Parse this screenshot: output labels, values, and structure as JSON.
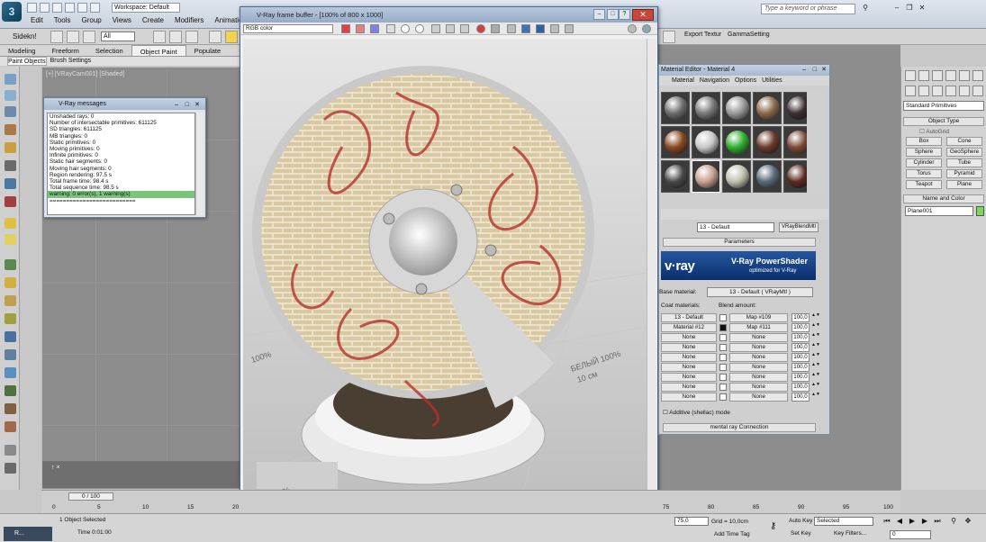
{
  "max": {
    "workspace": "Workspace: Default",
    "menu": [
      "Edit",
      "Tools",
      "Group",
      "Views",
      "Create",
      "Modifiers",
      "Animation"
    ],
    "help_search_placeholder": "Type a keyword or phrase",
    "selection_filter": "All",
    "select_mode": "Sidekn!",
    "toolbar_right": {
      "export": "Export Textur",
      "gamma": "GammaSetting"
    },
    "ribbon_tabs": [
      "Modeling",
      "Freeform",
      "Selection",
      "Object Paint",
      "Populate"
    ],
    "subribbon": [
      "Paint Objects",
      "Brush Settings"
    ]
  },
  "viewport": {
    "label": "[+] [VRayCam001] [Shaded]"
  },
  "vray_messages": {
    "title": "V-Ray messages",
    "lines": [
      "Unshaded rays: 0",
      "Number of intersectable primitives: 611125",
      "  SD triangles: 611125",
      "  MB triangles: 0",
      "  Static primitives: 0",
      "  Moving primitives: 0",
      "  Infinite primitives: 0",
      "  Static hair segments: 0",
      "  Moving hair segments: 0",
      "Region rendering: 97.5 s",
      "Total frame time: 98.4 s",
      "Total sequence time: 98.5 s",
      "warning: 0 error(s), 1 warning(s)",
      "=========================="
    ]
  },
  "vfb": {
    "title": "V-Ray frame buffer - [100% of 800 x 1000]",
    "channel": "RGB color",
    "scene_text": [
      "БЕЛЫЙ 100%",
      "10 см",
      "100%",
      "ЛЫЙ 100%",
      "см"
    ]
  },
  "material_editor": {
    "title": "Material Editor - Material 4",
    "menu": [
      "Material",
      "Navigation",
      "Options",
      "Utilities"
    ],
    "name_field": "13 - Default",
    "type_button": "VRayBlendMtl",
    "params_rollout": "Parameters",
    "banner": {
      "logo": "v·ray",
      "product": "V-Ray PowerShader",
      "subtitle": "optimized for V-Ray"
    },
    "base_label": "Base material:",
    "base_value": "13 - Default  ( VRayMtl )",
    "coat_label": "Coat materials:",
    "blend_label": "Blend amount:",
    "rows": [
      {
        "coat": "13 - Default",
        "blend": "Map #109",
        "amount": "100,0"
      },
      {
        "coat": "Material #12",
        "blend": "Map #111",
        "amount": "100,0"
      },
      {
        "coat": "None",
        "blend": "None",
        "amount": "100,0"
      },
      {
        "coat": "None",
        "blend": "None",
        "amount": "100,0"
      },
      {
        "coat": "None",
        "blend": "None",
        "amount": "100,0"
      },
      {
        "coat": "None",
        "blend": "None",
        "amount": "100,0"
      },
      {
        "coat": "None",
        "blend": "None",
        "amount": "100,0"
      },
      {
        "coat": "None",
        "blend": "None",
        "amount": "100,0"
      },
      {
        "coat": "None",
        "blend": "None",
        "amount": "100,0"
      }
    ],
    "additive_label": "Additive (shellac) mode",
    "mr_connection": "mental ray Connection",
    "slot_colors": [
      "#6e6e6e",
      "#7a7a7a",
      "#9a9a9a",
      "#8a6a4a",
      "#3a3030",
      "#8a4a20",
      "#c8c8c8",
      "#30b030",
      "#6a3a2a",
      "#7a4a35",
      "#4a4a4a",
      "#c8a090",
      "#c0c0b0",
      "#5a6a7a",
      "#5a2a20"
    ]
  },
  "command_panel": {
    "dropdown": "Standard Primitives",
    "object_type": "Object Type",
    "autogrid": "AutoGrid",
    "buttons": [
      "Box",
      "Cone",
      "Sphere",
      "GeoSphere",
      "Cylinder",
      "Tube",
      "Torus",
      "Pyramid",
      "Teapot",
      "Plane"
    ],
    "name_color": "Name and Color",
    "object_name": "Plane001"
  },
  "timeline": {
    "slider": "0 / 100",
    "ticks": [
      "0",
      "5",
      "10",
      "15",
      "20",
      "75",
      "80",
      "85",
      "90",
      "95",
      "100"
    ]
  },
  "status": {
    "selection": "1 Object Selected",
    "time": "Time 0:01:00",
    "app": "R...",
    "x": "75,0",
    "grid": "Grid = 10,0cm",
    "add_time_tag": "Add Time Tag",
    "auto_key": "Auto Key",
    "set_key": "Set Key",
    "selected": "Selected",
    "key_filters": "Key Filters...",
    "frame": "0"
  }
}
